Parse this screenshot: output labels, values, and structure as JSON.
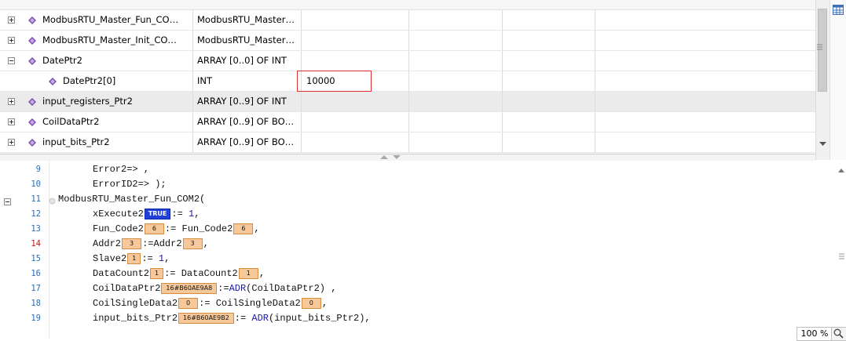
{
  "variables": [
    {
      "name": "ModbusRTU_Master_Fun_CO…",
      "type": "ModbusRTU_Master…",
      "value": "",
      "expander": "plus"
    },
    {
      "name": "ModbusRTU_Master_Init_CO…",
      "type": "ModbusRTU_Master…",
      "value": "",
      "expander": "plus"
    },
    {
      "name": "DatePtr2",
      "type": "ARRAY [0..0] OF INT",
      "value": "",
      "expander": "minus"
    },
    {
      "name": "DatePtr2[0]",
      "type": "INT",
      "value": "10000",
      "expander": "none"
    },
    {
      "name": "input_registers_Ptr2",
      "type": "ARRAY [0..9] OF INT",
      "value": "",
      "expander": "plus",
      "selected": true
    },
    {
      "name": "CoilDataPtr2",
      "type": "ARRAY [0..9] OF BO…",
      "value": "",
      "expander": "plus"
    },
    {
      "name": "input_bits_Ptr2",
      "type": "ARRAY [0..9] OF BO…",
      "value": "",
      "expander": "plus"
    }
  ],
  "code": {
    "line_numbers": [
      "9",
      "10",
      "11",
      "12",
      "13",
      "14",
      "15",
      "16",
      "17",
      "18",
      "19"
    ],
    "l9": "Error2=> ,",
    "l10": "ErrorID2=> );",
    "l11": "ModbusRTU_Master_Fun_COM2(",
    "l12_a": "xExecute2",
    "l12_mon": "TRUE",
    "l12_b": ":= ",
    "l12_num": "1",
    "l12_c": ",",
    "l13_a": "Fun_Code2",
    "l13_mon1": "6",
    "l13_b": ":= Fun_Code2",
    "l13_mon2": "6",
    "l13_c": ",",
    "l14_a": "Addr2",
    "l14_mon1": "3",
    "l14_b": ":=Addr2",
    "l14_mon2": "3",
    "l14_c": ",",
    "l15_a": "Slave2",
    "l15_mon": "1",
    "l15_b": ":= ",
    "l15_num": "1",
    "l15_c": ",",
    "l16_a": "DataCount2",
    "l16_mon1": "1",
    "l16_b": ":= DataCount2",
    "l16_mon2": "1",
    "l16_c": ",",
    "l17_a": "CoilDataPtr2",
    "l17_mon": "16#B60AE9A8",
    "l17_b": ":=",
    "l17_kw": "ADR",
    "l17_c": "(CoilDataPtr2) ,",
    "l18_a": "CoilSingleData2",
    "l18_mon1": "0",
    "l18_b": ":= CoilSingleData2",
    "l18_mon2": "0",
    "l18_c": ",",
    "l19_a": "input_bits_Ptr2",
    "l19_mon": "16#B60AE9B2",
    "l19_b": ":= ",
    "l19_kw": "ADR",
    "l19_c": "(input_bits_Ptr2),"
  },
  "status": {
    "zoom": "100 %"
  },
  "colors": {
    "monitor_bg": "#f7c99a",
    "monitor_true": "#1f3fd8",
    "highlight_box": "#e03030",
    "line_number": "#2b6fb6"
  }
}
